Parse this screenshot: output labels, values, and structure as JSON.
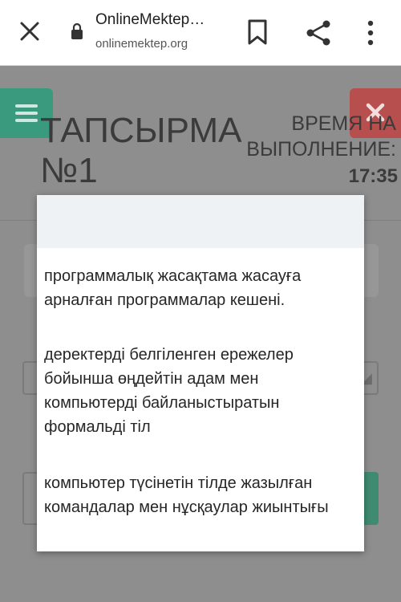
{
  "browser": {
    "title": "OnlineMektep…",
    "url": "onlinemektep.org"
  },
  "task": {
    "title_line1": "ТАПСЫРМА",
    "title_line2": "№1",
    "time_label_line1": "ВРЕМЯ НА",
    "time_label_line2": "ВЫПОЛНЕНИЕ:",
    "time_value": "17:35"
  },
  "dropdown": {
    "options": [
      "программалық жасақтама жасауға арналған программалар кешені.",
      "деректерді белгіленген ережелер бойынша өңдейтін адам мен компьютерді байланыстыратын формальді тіл",
      "компьютер түсінетін тілде жазылған командалар мен нұсқаулар жиынтығы"
    ]
  },
  "colors": {
    "menu_button": "#3a9a7e",
    "close_button": "#b84f4f",
    "overlay": "#8e8e8e"
  }
}
